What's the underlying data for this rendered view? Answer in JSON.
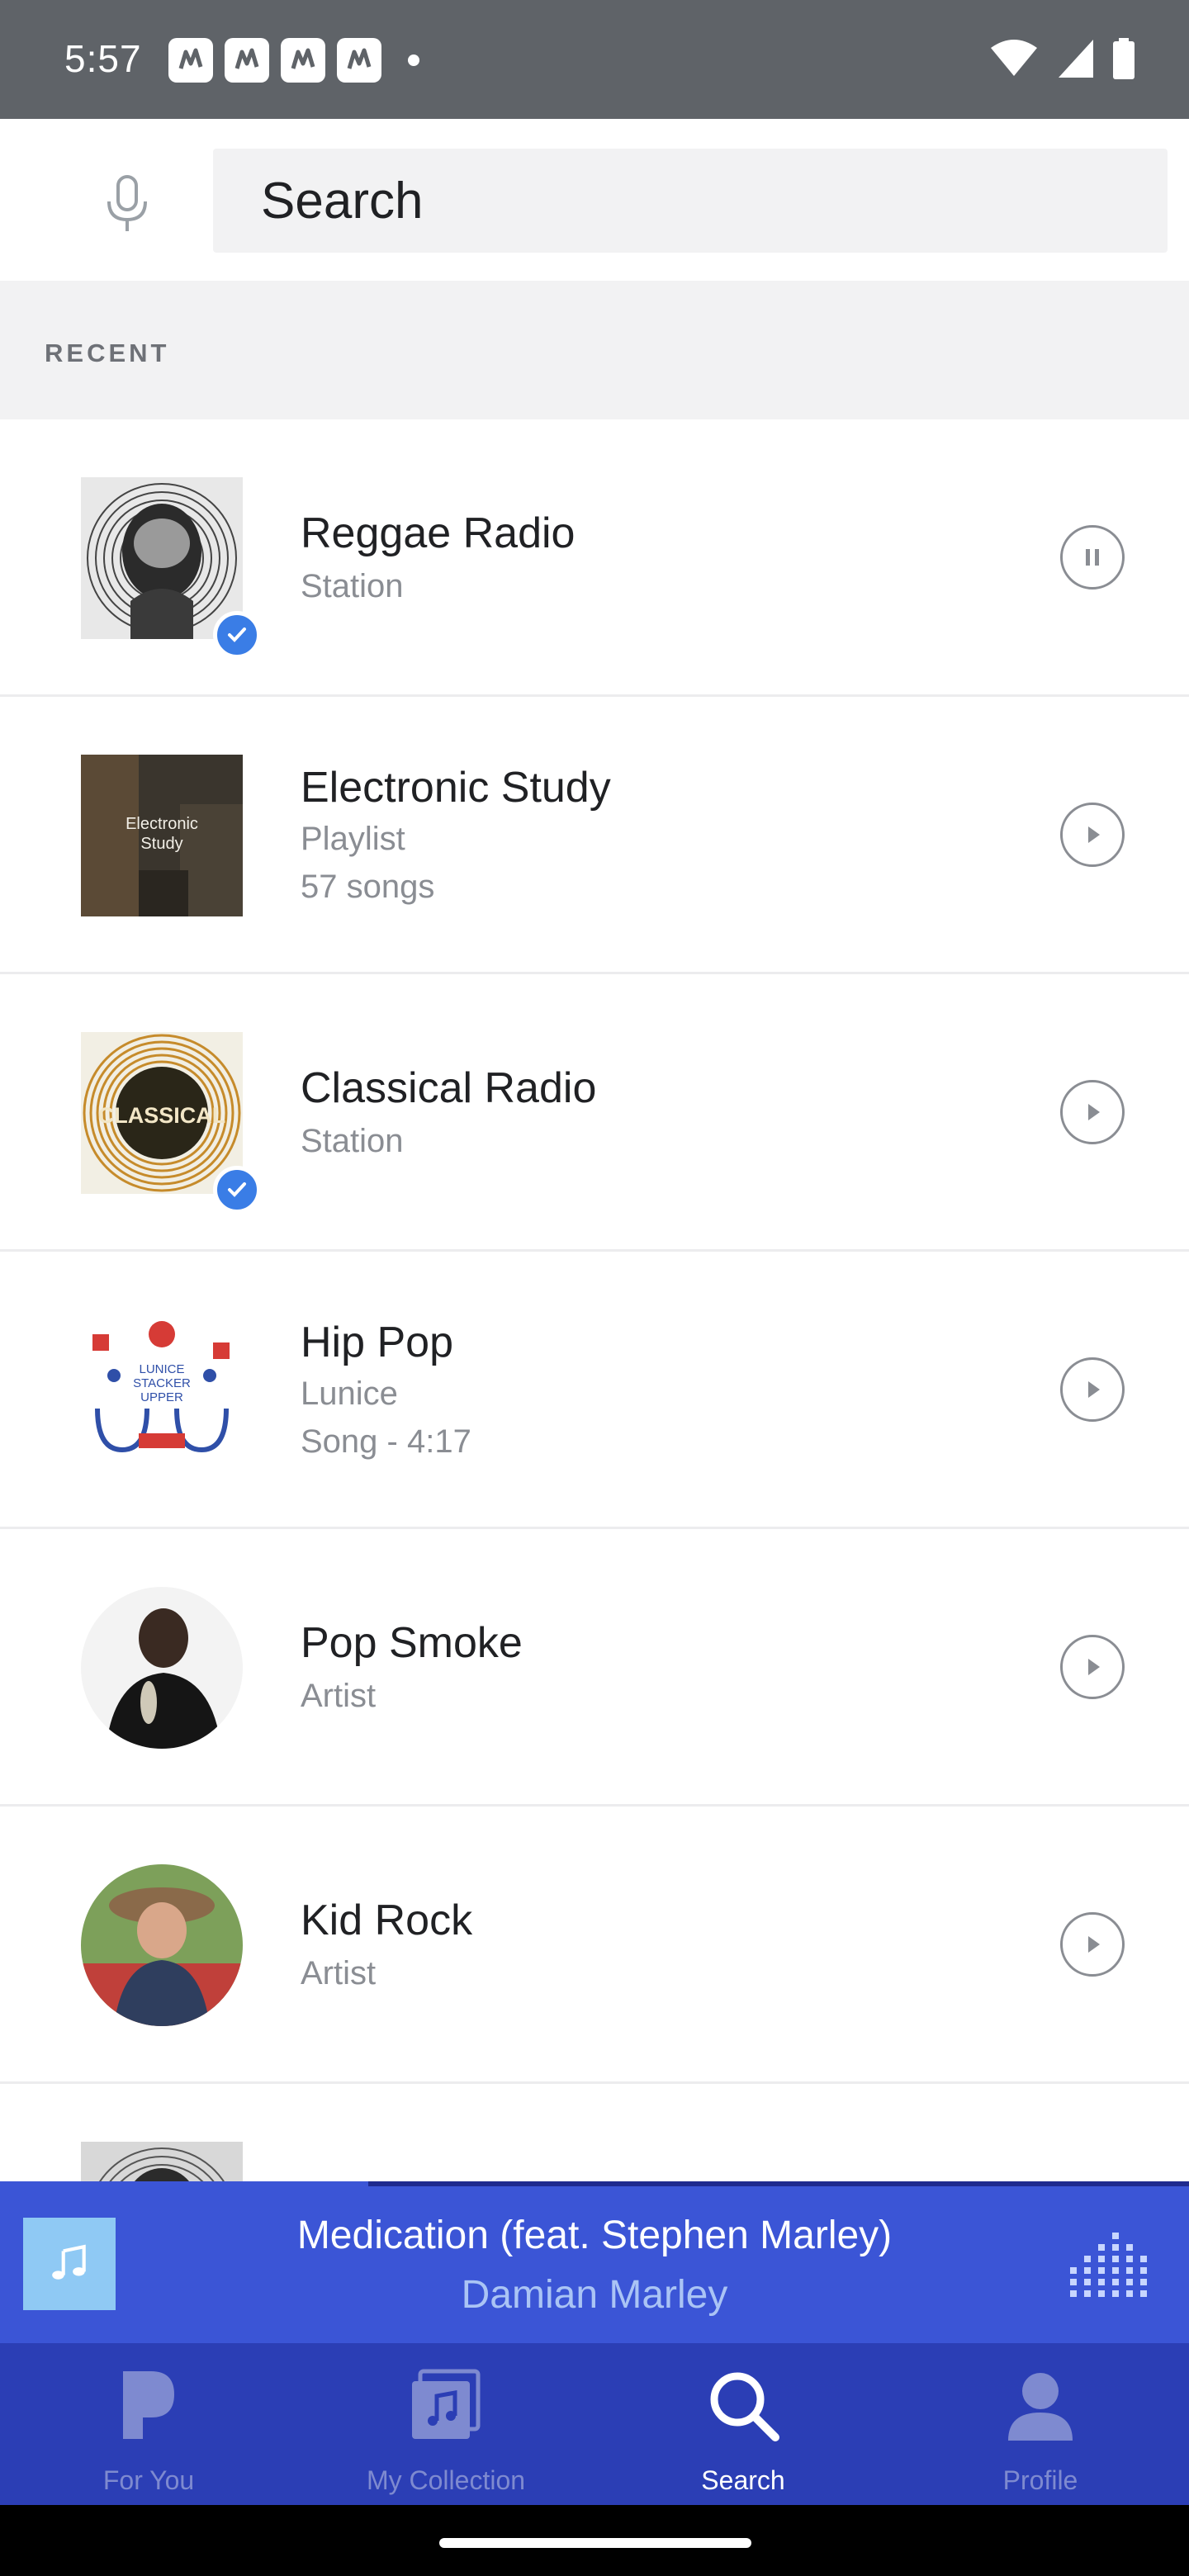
{
  "status_bar": {
    "time": "5:57"
  },
  "search": {
    "placeholder": "Search"
  },
  "recent_header": "RECENT",
  "items": [
    {
      "title": "Reggae Radio",
      "subtitle": "Station",
      "state": "pause",
      "downloaded": true
    },
    {
      "title": "Electronic Study",
      "subtitle": "Playlist",
      "subtitle2": "57 songs",
      "state": "play",
      "downloaded": false,
      "art_text": "Electronic Study"
    },
    {
      "title": "Classical Radio",
      "subtitle": "Station",
      "state": "play",
      "downloaded": true,
      "art_text": "CLASSICAL"
    },
    {
      "title": "Hip Pop",
      "subtitle": "Lunice",
      "subtitle2": "Song - 4:17",
      "state": "play",
      "downloaded": false,
      "art_text": "LUNICE STACKER UPPER"
    },
    {
      "title": "Pop Smoke",
      "subtitle": "Artist",
      "state": "play",
      "downloaded": false
    },
    {
      "title": "Kid Rock",
      "subtitle": "Artist",
      "state": "play",
      "downloaded": false
    }
  ],
  "now_playing": {
    "title": "Medication (feat. Stephen Marley)",
    "artist": "Damian Marley",
    "progress": 0.31
  },
  "nav": [
    {
      "label": "For You",
      "icon": "pandora-p-icon",
      "active": false
    },
    {
      "label": "My Collection",
      "icon": "collection-icon",
      "active": false
    },
    {
      "label": "Search",
      "icon": "search-icon",
      "active": true
    },
    {
      "label": "Profile",
      "icon": "profile-icon",
      "active": false
    }
  ],
  "colors": {
    "accent": "#3b55d6",
    "nav_bg": "#2b3eb5",
    "check": "#3a7de6"
  }
}
